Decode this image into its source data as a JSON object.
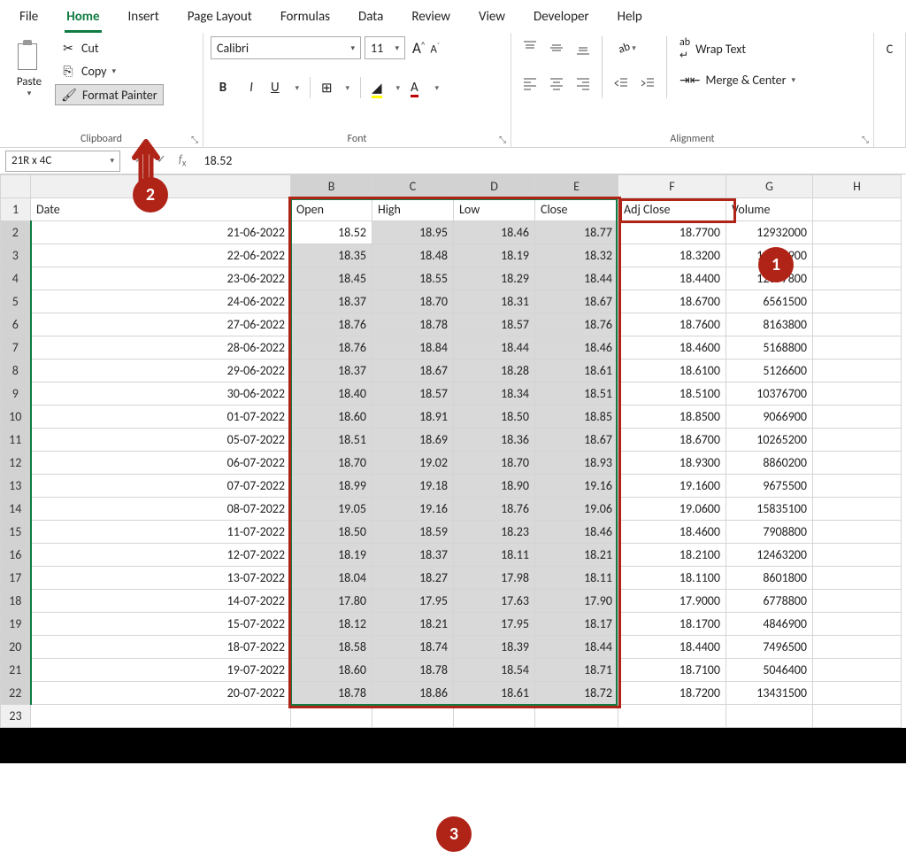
{
  "tabs": [
    "File",
    "Home",
    "Insert",
    "Page Layout",
    "Formulas",
    "Data",
    "Review",
    "View",
    "Developer",
    "Help"
  ],
  "activeTab": "Home",
  "clipboard": {
    "paste": "Paste",
    "cut": "Cut",
    "copy": "Copy",
    "formatPainter": "Format Painter",
    "groupLabel": "Clipboard"
  },
  "font": {
    "name": "Calibri",
    "size": "11",
    "groupLabel": "Font"
  },
  "alignment": {
    "wrap": "Wrap Text",
    "merge": "Merge & Center",
    "groupLabel": "Alignment"
  },
  "nameBox": "21R x 4C",
  "formula": "18.52",
  "columns": [
    "A",
    "B",
    "C",
    "D",
    "E",
    "F",
    "G",
    "H"
  ],
  "headers": {
    "A": "Date",
    "B": "Open",
    "C": "High",
    "D": "Low",
    "E": "Close",
    "F": "Adj Close",
    "G": "Volume"
  },
  "rows": [
    {
      "n": 2,
      "A": "21-06-2022",
      "B": "18.52",
      "C": "18.95",
      "D": "18.46",
      "E": "18.77",
      "F": "18.7700",
      "G": "12932000"
    },
    {
      "n": 3,
      "A": "22-06-2022",
      "B": "18.35",
      "C": "18.48",
      "D": "18.19",
      "E": "18.32",
      "F": "18.3200",
      "G": "12715900"
    },
    {
      "n": 4,
      "A": "23-06-2022",
      "B": "18.45",
      "C": "18.55",
      "D": "18.29",
      "E": "18.44",
      "F": "18.4400",
      "G": "12097800"
    },
    {
      "n": 5,
      "A": "24-06-2022",
      "B": "18.37",
      "C": "18.70",
      "D": "18.31",
      "E": "18.67",
      "F": "18.6700",
      "G": "6561500"
    },
    {
      "n": 6,
      "A": "27-06-2022",
      "B": "18.76",
      "C": "18.78",
      "D": "18.57",
      "E": "18.76",
      "F": "18.7600",
      "G": "8163800"
    },
    {
      "n": 7,
      "A": "28-06-2022",
      "B": "18.76",
      "C": "18.84",
      "D": "18.44",
      "E": "18.46",
      "F": "18.4600",
      "G": "5168800"
    },
    {
      "n": 8,
      "A": "29-06-2022",
      "B": "18.37",
      "C": "18.67",
      "D": "18.28",
      "E": "18.61",
      "F": "18.6100",
      "G": "5126600"
    },
    {
      "n": 9,
      "A": "30-06-2022",
      "B": "18.40",
      "C": "18.57",
      "D": "18.34",
      "E": "18.51",
      "F": "18.5100",
      "G": "10376700"
    },
    {
      "n": 10,
      "A": "01-07-2022",
      "B": "18.60",
      "C": "18.91",
      "D": "18.50",
      "E": "18.85",
      "F": "18.8500",
      "G": "9066900"
    },
    {
      "n": 11,
      "A": "05-07-2022",
      "B": "18.51",
      "C": "18.69",
      "D": "18.36",
      "E": "18.67",
      "F": "18.6700",
      "G": "10265200"
    },
    {
      "n": 12,
      "A": "06-07-2022",
      "B": "18.70",
      "C": "19.02",
      "D": "18.70",
      "E": "18.93",
      "F": "18.9300",
      "G": "8860200"
    },
    {
      "n": 13,
      "A": "07-07-2022",
      "B": "18.99",
      "C": "19.18",
      "D": "18.90",
      "E": "19.16",
      "F": "19.1600",
      "G": "9675500"
    },
    {
      "n": 14,
      "A": "08-07-2022",
      "B": "19.05",
      "C": "19.16",
      "D": "18.76",
      "E": "19.06",
      "F": "19.0600",
      "G": "15835100"
    },
    {
      "n": 15,
      "A": "11-07-2022",
      "B": "18.50",
      "C": "18.59",
      "D": "18.23",
      "E": "18.46",
      "F": "18.4600",
      "G": "7908800"
    },
    {
      "n": 16,
      "A": "12-07-2022",
      "B": "18.19",
      "C": "18.37",
      "D": "18.11",
      "E": "18.21",
      "F": "18.2100",
      "G": "12463200"
    },
    {
      "n": 17,
      "A": "13-07-2022",
      "B": "18.04",
      "C": "18.27",
      "D": "17.98",
      "E": "18.11",
      "F": "18.1100",
      "G": "8601800"
    },
    {
      "n": 18,
      "A": "14-07-2022",
      "B": "17.80",
      "C": "17.95",
      "D": "17.63",
      "E": "17.90",
      "F": "17.9000",
      "G": "6778800"
    },
    {
      "n": 19,
      "A": "15-07-2022",
      "B": "18.12",
      "C": "18.21",
      "D": "17.95",
      "E": "18.17",
      "F": "18.1700",
      "G": "4846900"
    },
    {
      "n": 20,
      "A": "18-07-2022",
      "B": "18.58",
      "C": "18.74",
      "D": "18.39",
      "E": "18.44",
      "F": "18.4400",
      "G": "7496500"
    },
    {
      "n": 21,
      "A": "19-07-2022",
      "B": "18.60",
      "C": "18.78",
      "D": "18.54",
      "E": "18.71",
      "F": "18.7100",
      "G": "5046400"
    },
    {
      "n": 22,
      "A": "20-07-2022",
      "B": "18.78",
      "C": "18.86",
      "D": "18.61",
      "E": "18.72",
      "F": "18.7200",
      "G": "13431500"
    }
  ],
  "annotations": {
    "1": "1",
    "2": "2",
    "3": "3"
  }
}
